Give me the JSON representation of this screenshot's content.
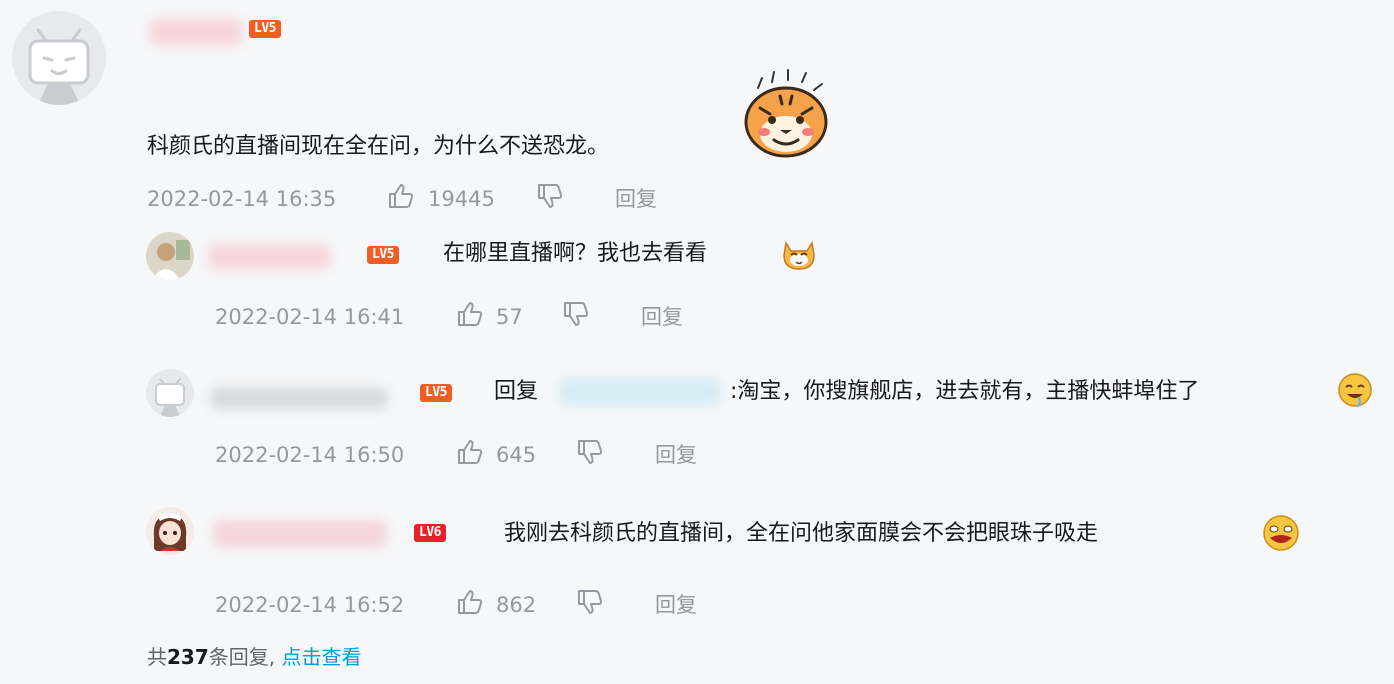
{
  "main_comment": {
    "level": "LV5",
    "text": "科颜氏的直播间现在全在问，为什么不送恐龙。",
    "time": "2022-02-14 16:35",
    "likes": "19445",
    "reply_label": "回复",
    "sticker": "tiger-sticker"
  },
  "replies": [
    {
      "level": "LV5",
      "text": "在哪里直播啊？我也去看看",
      "emoji": "cat-emoji",
      "time": "2022-02-14 16:41",
      "likes": "57",
      "reply_label": "回复"
    },
    {
      "level": "LV5",
      "prefix": "回复",
      "text": ":淘宝，你搜旗舰店，进去就有，主播快蚌埠住了",
      "emoji": "drooling-emoji",
      "time": "2022-02-14 16:50",
      "likes": "645",
      "reply_label": "回复"
    },
    {
      "level": "LV6",
      "text": "我刚去科颜氏的直播间，全在问他家面膜会不会把眼珠子吸走",
      "emoji": "shock-emoji",
      "time": "2022-02-14 16:52",
      "likes": "862",
      "reply_label": "回复"
    }
  ],
  "footer": {
    "prefix": "共",
    "count": "237",
    "suffix": "条回复,",
    "link": "点击查看"
  },
  "colors": {
    "badge_lv5": "#f25d24",
    "badge_lv6": "#e5222b",
    "link": "#00a1d6",
    "meta": "#9499a0"
  }
}
